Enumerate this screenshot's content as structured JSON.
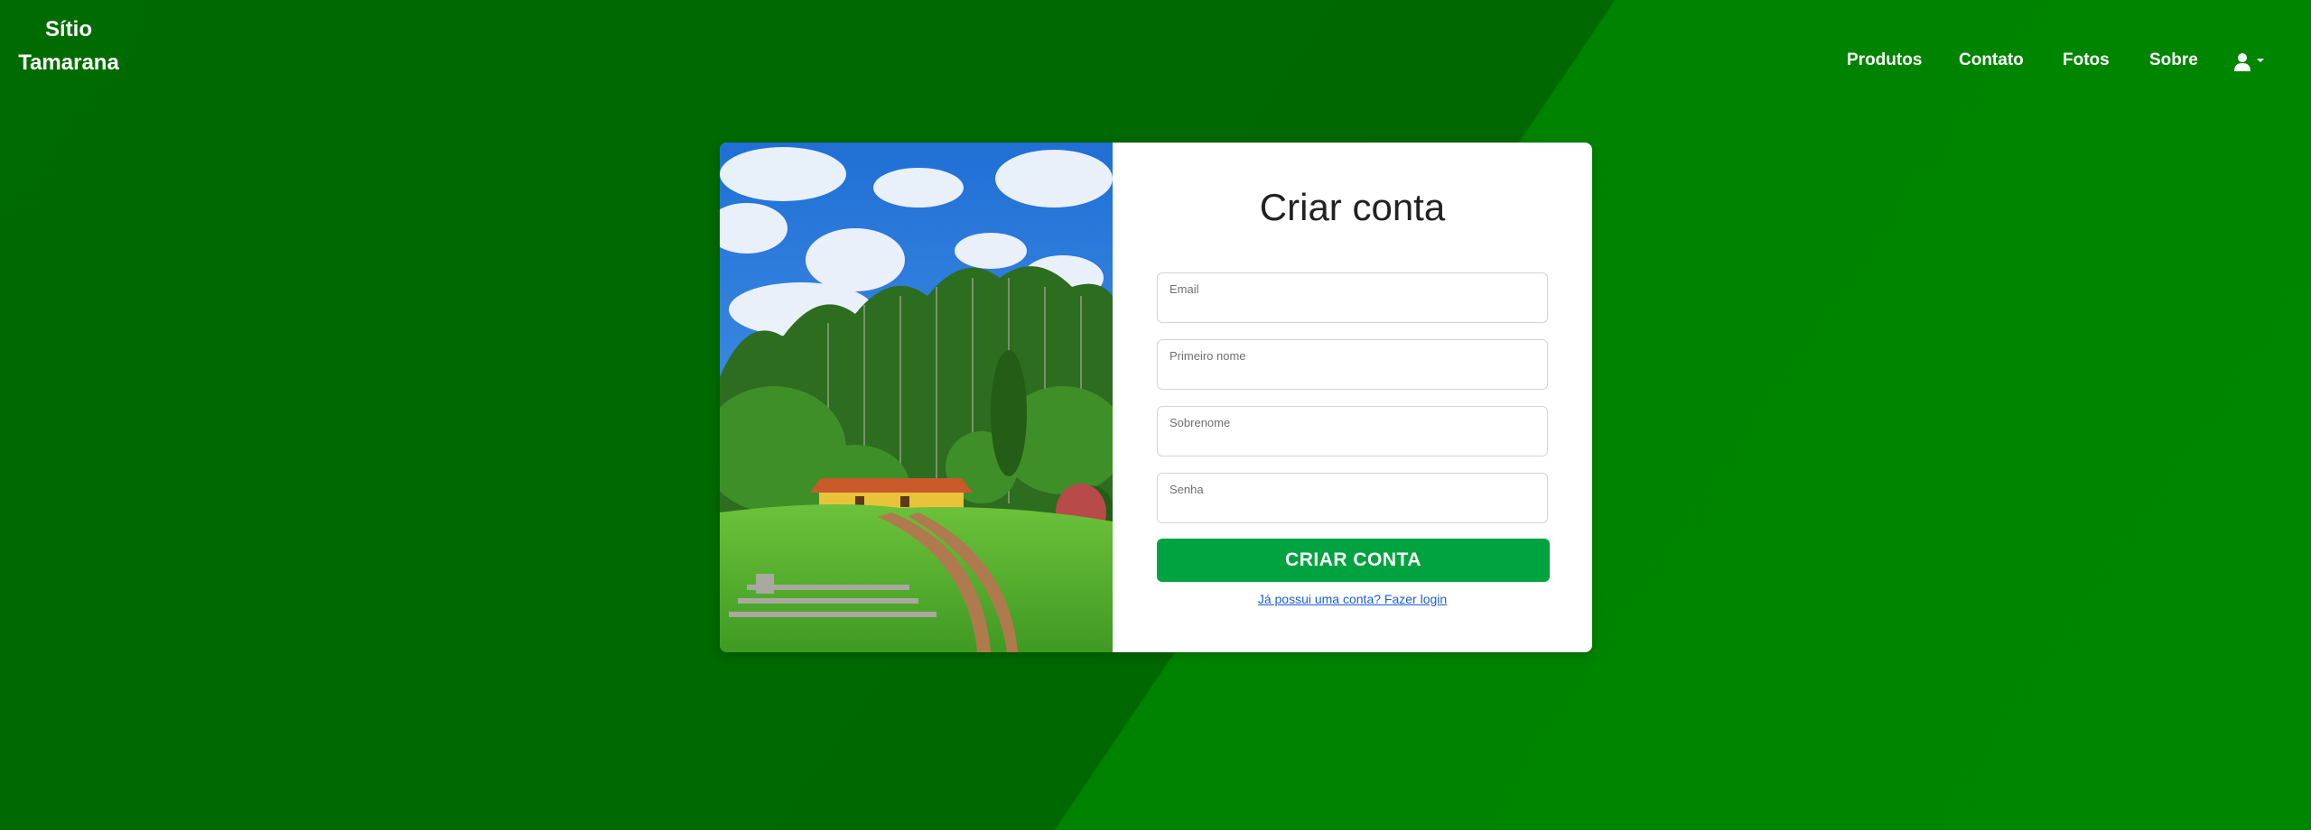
{
  "brand": {
    "line1": "Sítio",
    "line2": "Tamarana"
  },
  "nav": {
    "items": [
      {
        "label": "Produtos"
      },
      {
        "label": "Contato"
      },
      {
        "label": "Fotos"
      },
      {
        "label": "Sobre"
      }
    ],
    "user_menu_icon": "user-icon",
    "user_menu_caret": "caret-down-icon"
  },
  "signup": {
    "title": "Criar conta",
    "fields": [
      {
        "label": "Email",
        "value": ""
      },
      {
        "label": "Primeiro nome",
        "value": ""
      },
      {
        "label": "Sobrenome",
        "value": ""
      },
      {
        "label": "Senha",
        "value": ""
      }
    ],
    "submit_label": "CRIAR CONTA",
    "login_link": "Já possui uma conta? Fazer login"
  },
  "colors": {
    "background_dark": "#006b00",
    "background_light": "#008400",
    "button": "#00a33f",
    "link": "#1a5fd6"
  }
}
